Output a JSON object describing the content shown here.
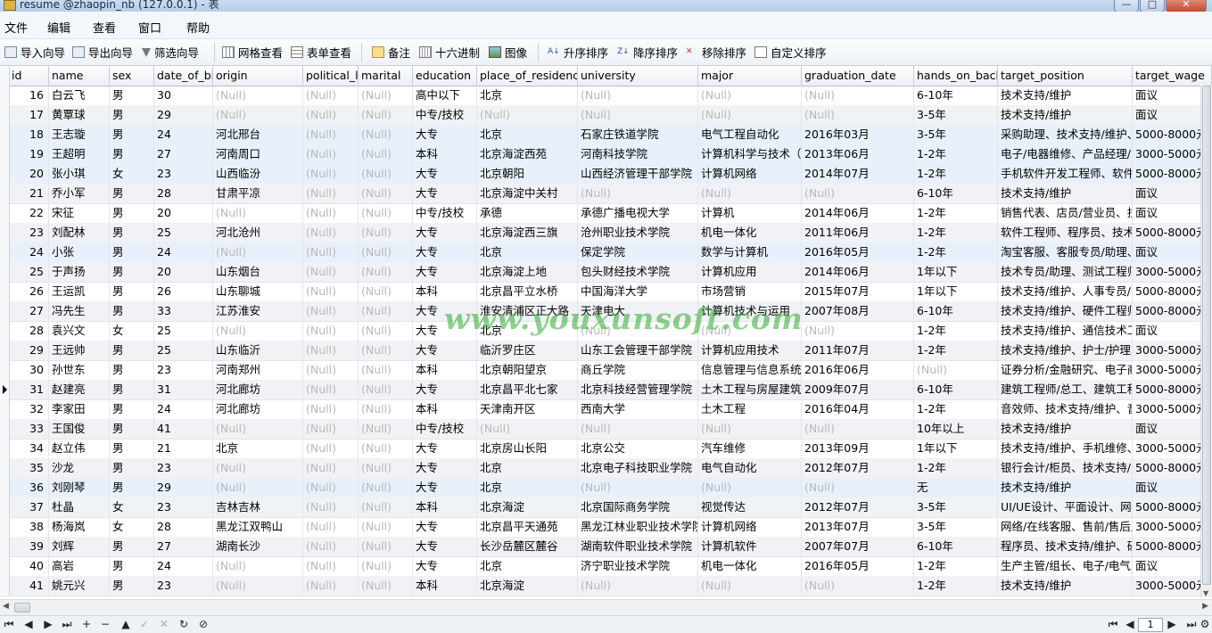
{
  "window": {
    "title": "resume @zhaopin_nb (127.0.0.1) - 表",
    "min_label": "—",
    "max_label": "□",
    "close_label": "✕"
  },
  "menu": [
    "文件",
    "编辑",
    "查看",
    "窗口",
    "帮助"
  ],
  "toolbar": {
    "import": "导入向导",
    "export": "导出向导",
    "filter": "筛选向导",
    "grid_view": "网格查看",
    "form_view": "表单查看",
    "memo": "备注",
    "hex": "十六进制",
    "image": "图像",
    "sort_asc": "升序排序",
    "sort_desc": "降序排序",
    "remove_sort": "移除排序",
    "custom_sort": "自定义排序"
  },
  "columns": [
    "id",
    "name",
    "sex",
    "date_of_bir",
    "origin",
    "political_la",
    "marital",
    "education",
    "place_of_residence",
    "university",
    "major",
    "graduation_date",
    "hands_on_backg",
    "target_position",
    "target_wage"
  ],
  "rows": [
    [
      "16",
      "白云飞",
      "男",
      "30",
      "(Null)",
      "(Null)",
      "(Null)",
      "高中以下",
      "北京",
      "(Null)",
      "(Null)",
      "(Null)",
      "6-10年",
      "技术支持/维护",
      "面议"
    ],
    [
      "17",
      "黄覃球",
      "男",
      "29",
      "(Null)",
      "(Null)",
      "(Null)",
      "中专/技校",
      "(Null)",
      "(Null)",
      "(Null)",
      "(Null)",
      "3-5年",
      "技术支持/维护",
      "面议"
    ],
    [
      "18",
      "王志璇",
      "男",
      "24",
      "河北邢台",
      "(Null)",
      "(Null)",
      "大专",
      "北京",
      "石家庄铁道学院",
      "电气工程自动化",
      "2016年03月",
      "3-5年",
      "采购助理、技术支持/维护、",
      "5000-8000元"
    ],
    [
      "19",
      "王超明",
      "男",
      "27",
      "河南周口",
      "(Null)",
      "(Null)",
      "本科",
      "北京海淀西苑",
      "河南科技学院",
      "计算机科学与技术（",
      "2013年06月",
      "1-2年",
      "电子/电器维修、产品经理/",
      "3000-5000元"
    ],
    [
      "20",
      "张小琪",
      "女",
      "23",
      "山西临汾",
      "(Null)",
      "(Null)",
      "大专",
      "北京朝阳",
      "山西经济管理干部学院",
      "计算机网络",
      "2014年07月",
      "1-2年",
      "手机软件开发工程师、软件",
      "5000-8000元"
    ],
    [
      "21",
      "乔小军",
      "男",
      "28",
      "甘肃平凉",
      "(Null)",
      "(Null)",
      "大专",
      "北京海淀中关村",
      "(Null)",
      "(Null)",
      "(Null)",
      "6-10年",
      "技术支持/维护",
      "面议"
    ],
    [
      "22",
      "宋征",
      "男",
      "20",
      "(Null)",
      "(Null)",
      "(Null)",
      "中专/技校",
      "承德",
      "承德广播电视大学",
      "计算机",
      "2014年06月",
      "1-2年",
      "销售代表、店员/营业员、技",
      "面议"
    ],
    [
      "23",
      "刘配林",
      "男",
      "25",
      "河北沧州",
      "(Null)",
      "(Null)",
      "大专",
      "北京海淀西三旗",
      "沧州职业技术学院",
      "机电一体化",
      "2011年06月",
      "1-2年",
      "软件工程师、程序员、技术",
      "5000-8000元"
    ],
    [
      "24",
      "小张",
      "男",
      "24",
      "(Null)",
      "(Null)",
      "(Null)",
      "大专",
      "北京",
      "保定学院",
      "数学与计算机",
      "2016年05月",
      "1-2年",
      "淘宝客服、客服专员/助理、",
      "面议"
    ],
    [
      "25",
      "于声扬",
      "男",
      "20",
      "山东烟台",
      "(Null)",
      "(Null)",
      "大专",
      "北京海淀上地",
      "包头财经技术学院",
      "计算机应用",
      "2014年06月",
      "1年以下",
      "技术专员/助理、测试工程师",
      "3000-5000元"
    ],
    [
      "26",
      "王运凯",
      "男",
      "26",
      "山东聊城",
      "(Null)",
      "(Null)",
      "本科",
      "北京昌平立水桥",
      "中国海洋大学",
      "市场营销",
      "2015年07月",
      "1年以下",
      "技术支持/维护、人事专员/",
      "5000-8000元"
    ],
    [
      "27",
      "冯先生",
      "男",
      "33",
      "江苏淮安",
      "(Null)",
      "(Null)",
      "大专",
      "淮安清浦区正大路",
      "天津电大",
      "计算机技术与运用",
      "2007年08月",
      "6-10年",
      "技术支持/维护、硬件工程师",
      "5000-8000元"
    ],
    [
      "28",
      "袁兴文",
      "女",
      "25",
      "(Null)",
      "(Null)",
      "(Null)",
      "大专",
      "北京",
      "(Null)",
      "(Null)",
      "(Null)",
      "1-2年",
      "技术支持/维护、通信技术工",
      "面议"
    ],
    [
      "29",
      "王远帅",
      "男",
      "25",
      "山东临沂",
      "(Null)",
      "(Null)",
      "大专",
      "临沂罗庄区",
      "山东工会管理干部学院",
      "计算机应用技术",
      "2011年07月",
      "1-2年",
      "技术支持/维护、护士/护理、",
      "3000-5000元"
    ],
    [
      "30",
      "孙世东",
      "男",
      "23",
      "河南郑州",
      "(Null)",
      "(Null)",
      "本科",
      "北京朝阳望京",
      "商丘学院",
      "信息管理与信息系统",
      "2016年06月",
      "(Null)",
      "证券分析/金融研究、电子商",
      "3000-5000元"
    ],
    [
      "31",
      "赵建亮",
      "男",
      "31",
      "河北廊坊",
      "(Null)",
      "(Null)",
      "大专",
      "北京昌平北七家",
      "北京科技经营管理学院",
      "土木工程与房屋建筑",
      "2009年07月",
      "6-10年",
      "建筑工程师/总工、建筑工程",
      "5000-8000元"
    ],
    [
      "32",
      "李家田",
      "男",
      "24",
      "河北廊坊",
      "(Null)",
      "(Null)",
      "本科",
      "天津南开区",
      "西南大学",
      "土木工程",
      "2016年04月",
      "1-2年",
      "音效师、技术支持/维护、音",
      "3000-5000元"
    ],
    [
      "33",
      "王国俊",
      "男",
      "41",
      "(Null)",
      "(Null)",
      "(Null)",
      "中专/技校",
      "(Null)",
      "(Null)",
      "(Null)",
      "(Null)",
      "10年以上",
      "技术支持/维护",
      "面议"
    ],
    [
      "34",
      "赵立伟",
      "男",
      "21",
      "北京",
      "(Null)",
      "(Null)",
      "大专",
      "北京房山长阳",
      "北京公交",
      "汽车维修",
      "2013年09月",
      "1年以下",
      "技术支持/维护、手机维修、",
      "3000-5000元"
    ],
    [
      "35",
      "沙龙",
      "男",
      "23",
      "(Null)",
      "(Null)",
      "(Null)",
      "大专",
      "北京",
      "北京电子科技职业学院",
      "电气自动化",
      "2012年07月",
      "1-2年",
      "银行会计/柜员、技术支持/",
      "5000-8000元"
    ],
    [
      "36",
      "刘刚琴",
      "男",
      "29",
      "(Null)",
      "(Null)",
      "(Null)",
      "大专",
      "北京",
      "(Null)",
      "(Null)",
      "(Null)",
      "无",
      "技术支持/维护",
      "面议"
    ],
    [
      "37",
      "杜晶",
      "女",
      "23",
      "吉林吉林",
      "(Null)",
      "(Null)",
      "本科",
      "北京海淀",
      "北京国际商务学院",
      "视觉传达",
      "2012年07月",
      "3-5年",
      "UI/UE设计、平面设计、网页",
      "5000-8000元"
    ],
    [
      "38",
      "杨海岚",
      "女",
      "28",
      "黑龙江双鸭山",
      "(Null)",
      "(Null)",
      "大专",
      "北京昌平天通苑",
      "黑龙江林业职业技术学院",
      "计算机网络",
      "2013年07月",
      "3-5年",
      "网络/在线客服、售前/售后服",
      "3000-5000元"
    ],
    [
      "39",
      "刘辉",
      "男",
      "27",
      "湖南长沙",
      "(Null)",
      "(Null)",
      "大专",
      "长沙岳麓区麓谷",
      "湖南软件职业技术学院",
      "计算机软件",
      "2007年07月",
      "6-10年",
      "程序员、技术支持/维护、硬",
      "5000-8000元"
    ],
    [
      "40",
      "高岩",
      "男",
      "24",
      "(Null)",
      "(Null)",
      "(Null)",
      "大专",
      "北京",
      "济宁职业技术学院",
      "机电一体化",
      "2016年05月",
      "1-2年",
      "生产主管/组长、电子/电气工",
      "面议"
    ],
    [
      "41",
      "姚元兴",
      "男",
      "23",
      "(Null)",
      "(Null)",
      "(Null)",
      "本科",
      "北京海淀",
      "(Null)",
      "(Null)",
      "(Null)",
      "1-2年",
      "技术支持/维护",
      "3000-5000元"
    ]
  ],
  "current_row_id": "31",
  "watermark": "www.youxunsoft.com",
  "nav": {
    "page": "1"
  }
}
